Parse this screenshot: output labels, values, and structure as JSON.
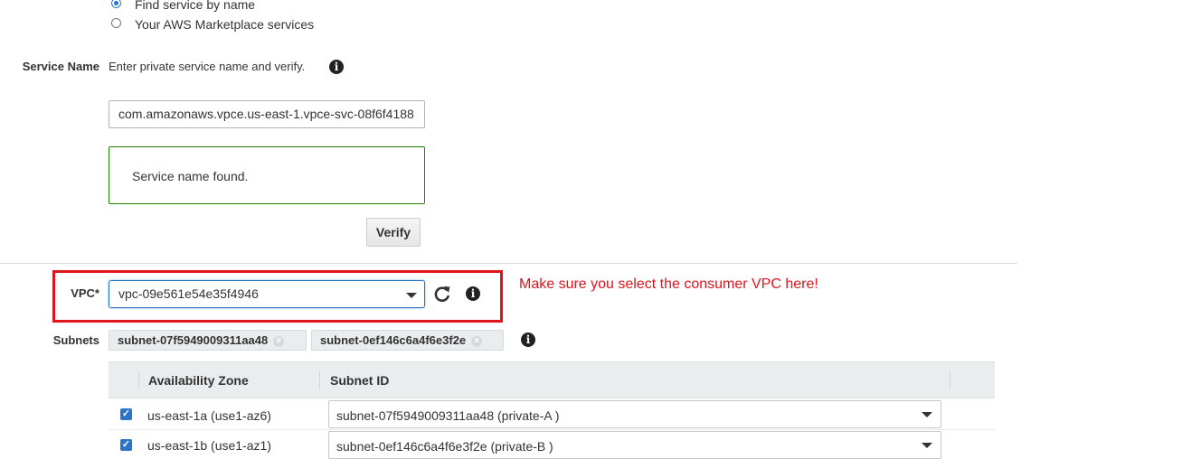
{
  "service_type": {
    "options": [
      {
        "label": "Find service by name",
        "selected": true
      },
      {
        "label": "Your AWS Marketplace services",
        "selected": false
      }
    ]
  },
  "service_name": {
    "label": "Service Name",
    "hint": "Enter private service name and verify.",
    "value": "com.amazonaws.vpce.us-east-1.vpce-svc-08f6f4188",
    "success_message": "Service name found.",
    "verify_label": "Verify"
  },
  "vpc": {
    "label": "VPC*",
    "value": "vpc-09e561e54e35f4946",
    "annotation": "Make sure you select the consumer VPC here!"
  },
  "subnets": {
    "label": "Subnets",
    "tokens": [
      "subnet-07f5949009311aa48",
      "subnet-0ef146c6a4f6e3f2e"
    ],
    "columns": [
      "Availability Zone",
      "Subnet ID"
    ],
    "rows": [
      {
        "checked": true,
        "zone": "us-east-1a (use1-az6)",
        "subnet": "subnet-07f5949009311aa48 (private-A )"
      },
      {
        "checked": true,
        "zone": "us-east-1b (use1-az1)",
        "subnet": "subnet-0ef146c6a4f6e3f2e (private-B )"
      }
    ]
  },
  "colors": {
    "annotation_red": "#e0141c",
    "accent_blue": "#2b74c7",
    "success_green": "#1d8102"
  }
}
